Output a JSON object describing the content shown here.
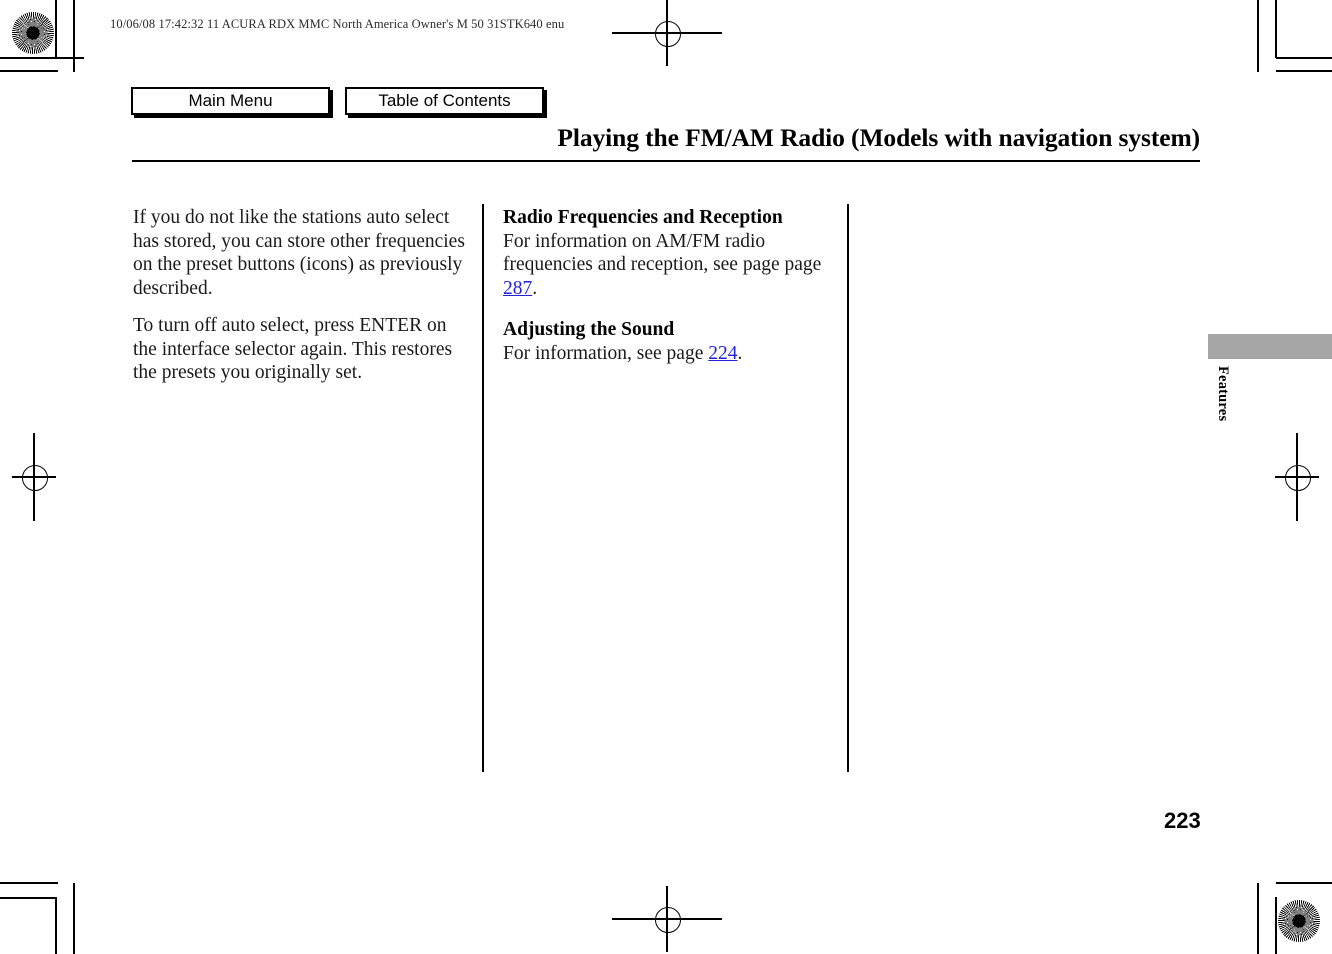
{
  "header": {
    "slug": "10/06/08 17:42:32   11 ACURA RDX MMC North America Owner's M 50 31STK640 enu"
  },
  "nav": {
    "main_menu_label": "Main Menu",
    "table_of_contents_label": "Table of Contents"
  },
  "title": "Playing the FM/AM Radio (Models with navigation system)",
  "columns": {
    "left": {
      "paragraph_1": "If you do not like the stations auto select has stored, you can store other frequencies on the preset buttons (icons) as previously described.",
      "paragraph_2": "To turn off auto select, press ENTER on the interface selector again. This restores the presets you originally set."
    },
    "middle": {
      "section_1": {
        "heading": "Radio Frequencies and Reception",
        "body_before_ref": "For information on AM/FM radio frequencies and reception, see page page ",
        "page_ref": "287",
        "body_after_ref": "."
      },
      "section_2": {
        "heading": "Adjusting the Sound",
        "body_before_ref": "For information, see page ",
        "page_ref": "224",
        "body_after_ref": "."
      }
    }
  },
  "side_tab": {
    "label": "Features",
    "bar_color": "#a6a6a6"
  },
  "folio": {
    "page_number": "223"
  },
  "colors": {
    "link_blue": "#2222dd",
    "ink_black": "#1a1a1a",
    "tab_gray": "#a6a6a6"
  }
}
